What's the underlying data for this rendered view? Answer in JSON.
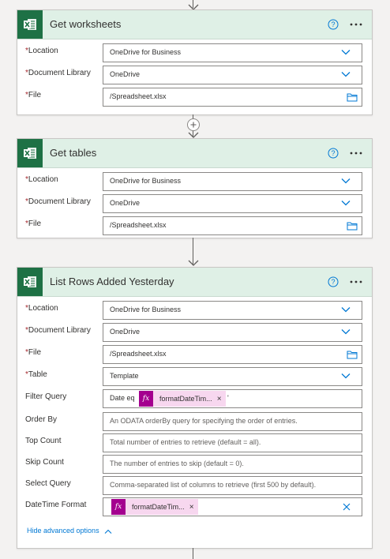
{
  "colors": {
    "excel_green": "#1e7145",
    "header_bg": "#dff0e6",
    "token_bg": "#f7d7ef",
    "token_fx": "#a4008f",
    "link_blue": "#0078d4",
    "required_red": "#a4262c"
  },
  "icons": {
    "connector": "excel-icon",
    "help": "help-circle-icon",
    "more": "more-icon",
    "dropdown": "chevron-down-icon",
    "file_picker": "folder-icon",
    "insert": "plus-circle-icon",
    "flow_arrow": "arrow-down-icon",
    "clear": "close-icon"
  },
  "cards": {
    "worksheets": {
      "title": "Get worksheets",
      "location_label": "Location",
      "location_value": "OneDrive for Business",
      "library_label": "Document Library",
      "library_value": "OneDrive",
      "file_label": "File",
      "file_value": "/Spreadsheet.xlsx"
    },
    "tables": {
      "title": "Get tables",
      "location_label": "Location",
      "location_value": "OneDrive for Business",
      "library_label": "Document Library",
      "library_value": "OneDrive",
      "file_label": "File",
      "file_value": "/Spreadsheet.xlsx"
    },
    "list_rows": {
      "title": "List Rows Added Yesterday",
      "location_label": "Location",
      "location_value": "OneDrive for Business",
      "library_label": "Document Library",
      "library_value": "OneDrive",
      "file_label": "File",
      "file_value": "/Spreadsheet.xlsx",
      "table_label": "Table",
      "table_value": "Template",
      "filter_label": "Filter Query",
      "filter_prefix": "Date eq",
      "filter_token": "formatDateTim...",
      "filter_suffix": "'",
      "orderby_label": "Order By",
      "orderby_placeholder": "An ODATA orderBy query for specifying the order of entries.",
      "top_label": "Top Count",
      "top_placeholder": "Total number of entries to retrieve (default = all).",
      "skip_label": "Skip Count",
      "skip_placeholder": "The number of entries to skip (default = 0).",
      "select_label": "Select Query",
      "select_placeholder": "Comma-separated list of columns to retrieve (first 500 by default).",
      "datetime_label": "DateTime Format",
      "datetime_token": "formatDateTim...",
      "advanced_link": "Hide advanced options"
    }
  },
  "common": {
    "required_mark": "*",
    "fx_label": "fx",
    "token_close": "×",
    "help_glyph": "?"
  }
}
